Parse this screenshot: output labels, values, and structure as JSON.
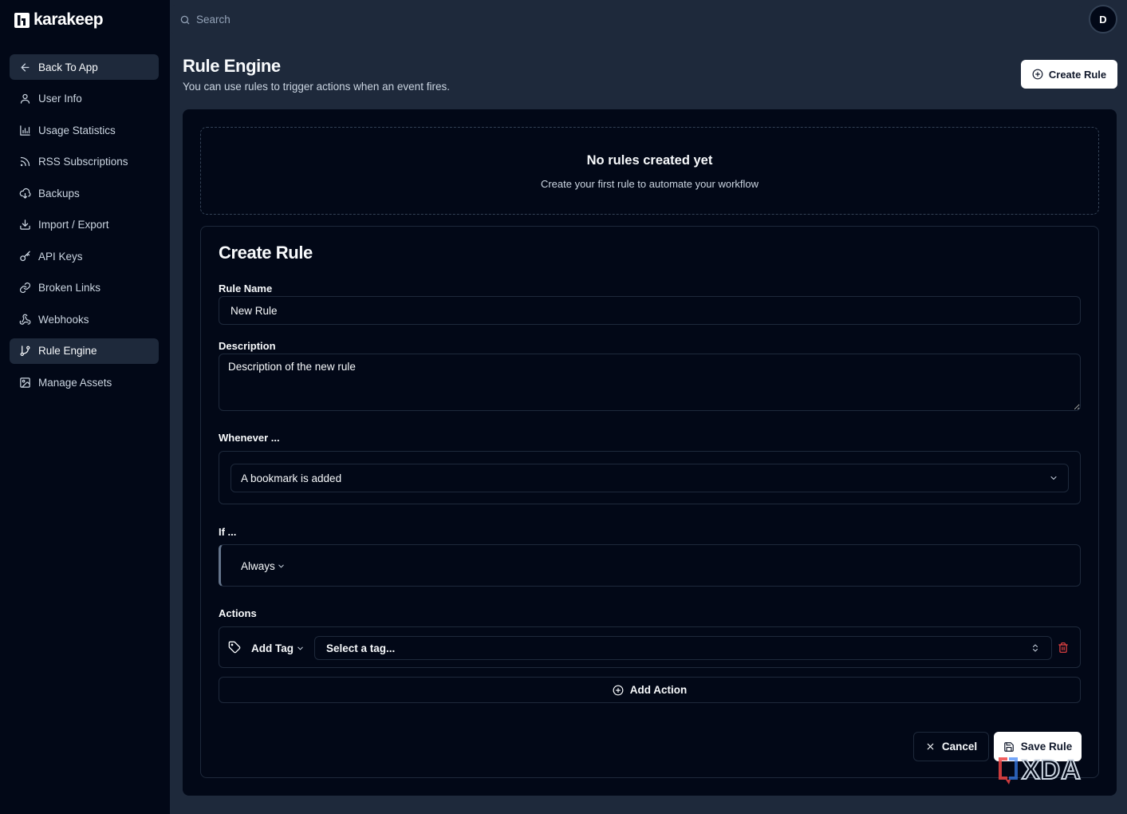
{
  "app": {
    "brand": "karakeep",
    "avatar_initial": "D"
  },
  "search": {
    "placeholder": "Search"
  },
  "sidebar": {
    "items": [
      {
        "label": "Back To App",
        "icon": "arrow-left-icon",
        "active": true
      },
      {
        "label": "User Info",
        "icon": "user-icon"
      },
      {
        "label": "Usage Statistics",
        "icon": "bar-chart-icon"
      },
      {
        "label": "RSS Subscriptions",
        "icon": "rss-icon"
      },
      {
        "label": "Backups",
        "icon": "cloud-download-icon"
      },
      {
        "label": "Import / Export",
        "icon": "download-icon"
      },
      {
        "label": "API Keys",
        "icon": "key-icon"
      },
      {
        "label": "Broken Links",
        "icon": "link-icon"
      },
      {
        "label": "Webhooks",
        "icon": "webhook-icon"
      },
      {
        "label": "Rule Engine",
        "icon": "git-branch-icon",
        "active": true
      },
      {
        "label": "Manage Assets",
        "icon": "image-icon"
      }
    ]
  },
  "header": {
    "title": "Rule Engine",
    "subtitle": "You can use rules to trigger actions when an event fires.",
    "create_button": "Create Rule"
  },
  "empty_state": {
    "title": "No rules created yet",
    "subtitle": "Create your first rule to automate your workflow"
  },
  "form": {
    "title": "Create Rule",
    "rule_name_label": "Rule Name",
    "rule_name_value": "New Rule",
    "description_label": "Description",
    "description_value": "Description of the new rule",
    "whenever_label": "Whenever ...",
    "event_value": "A bookmark is added",
    "if_label": "If ...",
    "condition_value": "Always",
    "actions_label": "Actions",
    "action_type": "Add Tag",
    "tag_placeholder": "Select a tag...",
    "add_action_button": "Add Action",
    "cancel_button": "Cancel",
    "save_button": "Save Rule"
  },
  "watermark": {
    "text": "XDA"
  },
  "colors": {
    "sidebar_bg": "#020817",
    "page_bg": "#1e293b",
    "card_bg": "#020817",
    "border": "#1e293b",
    "danger": "#ef4444",
    "primary_button_bg": "#ffffff"
  }
}
